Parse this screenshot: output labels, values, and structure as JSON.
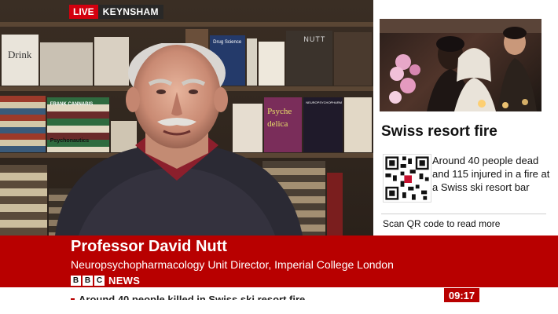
{
  "live_badge": {
    "live": "LIVE",
    "location": "KEYNSHAM"
  },
  "video": {
    "book_titles": [
      "Drink",
      "Drug Science",
      "NUTT",
      "Psyche delica",
      "NEUROPSYCHOPHARM",
      "Psychonautics",
      "FRANK CANNABIS"
    ]
  },
  "side_panel": {
    "title": "Swiss resort fire",
    "description": "Around 40 people dead and 115 injured in a fire at a Swiss ski resort bar",
    "qr_label": "Scan QR code to read more"
  },
  "lower_third": {
    "name": "Professor David Nutt",
    "role": "Neuropsychopharmacology Unit Director, Imperial College London",
    "brand_letters": [
      "B",
      "B",
      "C"
    ],
    "brand_word": "NEWS"
  },
  "ticker": {
    "text": "Around 40 people killed in Swiss ski resort fire"
  },
  "clock": "09:17",
  "colors": {
    "bbc_red": "#b80000",
    "live_red": "#d4000e"
  },
  "icons": {
    "qr": "qr-code-icon"
  }
}
